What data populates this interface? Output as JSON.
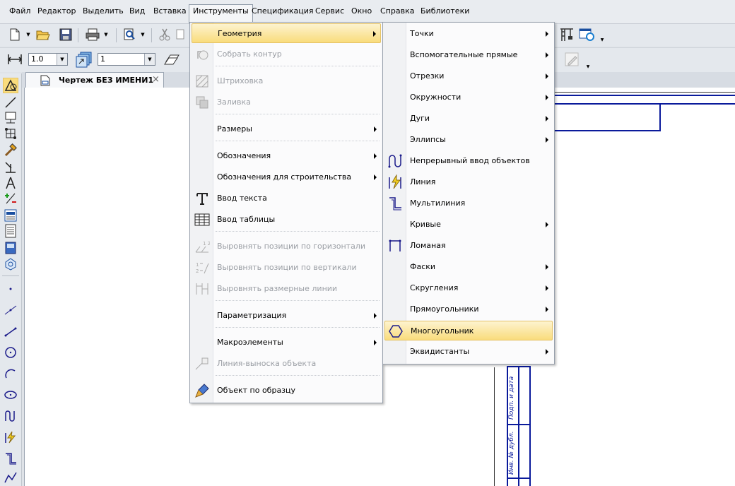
{
  "menubar": {
    "items": [
      "Файл",
      "Редактор",
      "Выделить",
      "Вид",
      "Вставка",
      "Инструменты",
      "Спецификация",
      "Сервис",
      "Окно",
      "Справка",
      "Библиотеки"
    ],
    "active": "Инструменты"
  },
  "toolbar2": {
    "line_scale": "1.0",
    "layer": "1"
  },
  "doc_tab": {
    "title": "Чертеж БЕЗ ИМЕНИ1",
    "close": "×"
  },
  "tools_menu": {
    "items": [
      {
        "label": "Геометрия",
        "submenu": true,
        "highlighted": true,
        "icon": ""
      },
      {
        "label": "Собрать контур",
        "disabled": true,
        "icon": "collect-contour-icon"
      },
      {
        "label": "Штриховка",
        "disabled": true,
        "icon": "hatch-icon"
      },
      {
        "label": "Заливка",
        "disabled": true,
        "icon": "fill-icon"
      },
      {
        "label": "Размеры",
        "submenu": true,
        "icon": ""
      },
      {
        "label": "Обозначения",
        "submenu": true,
        "icon": ""
      },
      {
        "label": "Обозначения для строительства",
        "submenu": true,
        "icon": ""
      },
      {
        "label": "Ввод текста",
        "icon": "text-input-icon"
      },
      {
        "label": "Ввод таблицы",
        "icon": "table-input-icon"
      },
      {
        "label": "Выровнять позиции по горизонтали",
        "disabled": true,
        "icon": "align-horizontal-icon"
      },
      {
        "label": "Выровнять позиции по вертикали",
        "disabled": true,
        "icon": "align-vertical-icon"
      },
      {
        "label": "Выровнять размерные линии",
        "disabled": true,
        "icon": "align-dim-lines-icon"
      },
      {
        "label": "Параметризация",
        "submenu": true,
        "icon": ""
      },
      {
        "label": "Макроэлементы",
        "submenu": true,
        "icon": ""
      },
      {
        "label": "Линия-выноска объекта",
        "disabled": true,
        "icon": "leader-line-icon"
      },
      {
        "label": "Объект по образцу",
        "icon": "brush-icon"
      }
    ]
  },
  "geometry_menu": {
    "items": [
      {
        "label": "Точки",
        "submenu": true,
        "icon": ""
      },
      {
        "label": "Вспомогательные прямые",
        "submenu": true,
        "icon": ""
      },
      {
        "label": "Отрезки",
        "submenu": true,
        "icon": ""
      },
      {
        "label": "Окружности",
        "submenu": true,
        "icon": ""
      },
      {
        "label": "Дуги",
        "submenu": true,
        "icon": ""
      },
      {
        "label": "Эллипсы",
        "submenu": true,
        "icon": ""
      },
      {
        "label": "Непрерывный ввод объектов",
        "icon": "continuous-input-icon"
      },
      {
        "label": "Линия",
        "icon": "line-icon"
      },
      {
        "label": "Мультилиния",
        "icon": "multiline-icon"
      },
      {
        "label": "Кривые",
        "submenu": true,
        "icon": ""
      },
      {
        "label": "Ломаная",
        "icon": "polyline-icon"
      },
      {
        "label": "Фаски",
        "submenu": true,
        "icon": ""
      },
      {
        "label": "Скругления",
        "submenu": true,
        "icon": ""
      },
      {
        "label": "Прямоугольники",
        "submenu": true,
        "icon": ""
      },
      {
        "label": "Многоугольник",
        "highlighted": true,
        "icon": "polygon-icon"
      },
      {
        "label": "Эквидистанты",
        "submenu": true,
        "icon": ""
      }
    ]
  },
  "title_block": {
    "sign_date": "Подп. и дата",
    "inv_dupl": "Инв. № дубл."
  }
}
